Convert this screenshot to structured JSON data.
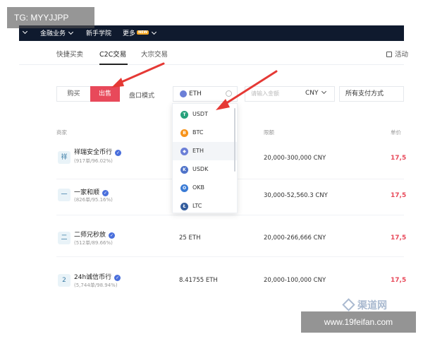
{
  "watermark_top": "TG: MYYJJPP",
  "watermark_bottom": "www.19feifan.com",
  "watermark_logo": "渠道网",
  "nav": {
    "items": [
      {
        "label": "金融业务",
        "has_chevron": true
      },
      {
        "label": "新手学院"
      },
      {
        "label": "更多",
        "badge": "NEW",
        "has_chevron": true
      }
    ]
  },
  "tabs": {
    "items": [
      "快捷买卖",
      "C2C交易",
      "大宗交易"
    ],
    "active": "C2C交易",
    "activity": "活动"
  },
  "filters": {
    "buy": "购买",
    "sell": "出售",
    "mode": "盘口模式",
    "coin": "ETH",
    "amount_placeholder": "请输入金额",
    "currency": "CNY",
    "payment": "所有支付方式"
  },
  "table": {
    "headers": {
      "merchant": "商家",
      "limit": "限额",
      "price": "单价"
    },
    "rows": [
      {
        "avatar": "祥",
        "name": "祥瑞安全币行",
        "stats": "(917单/96.02%)",
        "qty": "",
        "limit": "20,000-300,000 CNY",
        "price": "17,5"
      },
      {
        "avatar": "一",
        "name": "一家和顺",
        "stats": "(826单/95.16%)",
        "qty": "",
        "limit": "30,000-52,560.3 CNY",
        "price": "17,5"
      },
      {
        "avatar": "二",
        "name": "二师兄秒放",
        "stats": "(512单/89.66%)",
        "qty": "25 ETH",
        "limit": "20,000-266,666 CNY",
        "price": "17,5"
      },
      {
        "avatar": "2",
        "name": "24h诚信币行",
        "stats": "(5,744单/98.94%)",
        "qty": "8.41755 ETH",
        "limit": "20,000-100,000 CNY",
        "price": "17,5"
      }
    ]
  },
  "dropdown": {
    "options": [
      {
        "symbol": "USDT",
        "color": "#26a17b",
        "glyph": "T"
      },
      {
        "symbol": "BTC",
        "color": "#f7931a",
        "glyph": "B"
      },
      {
        "symbol": "ETH",
        "color": "#6b7fd7",
        "glyph": "◆",
        "highlighted": true
      },
      {
        "symbol": "USDK",
        "color": "#4f73c9",
        "glyph": "K"
      },
      {
        "symbol": "OKB",
        "color": "#3a7bd5",
        "glyph": "O"
      },
      {
        "symbol": "LTC",
        "color": "#345d9d",
        "glyph": "Ł"
      }
    ]
  },
  "colors": {
    "accent": "#e8495a",
    "nav_bg": "#0f1a2e",
    "arrow": "#e53935"
  }
}
